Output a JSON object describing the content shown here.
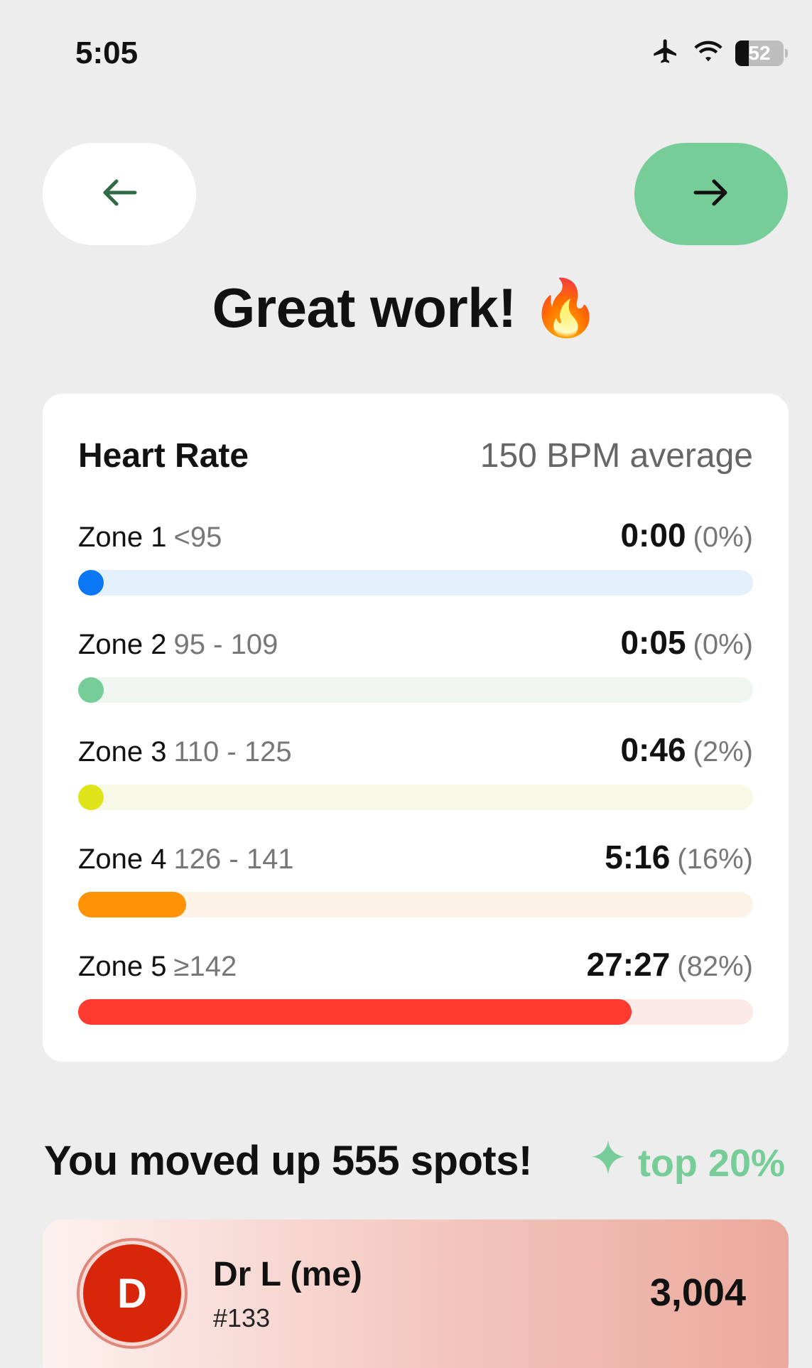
{
  "status_bar": {
    "time": "5:05",
    "battery": "52",
    "battery_level_percent": 52
  },
  "nav": {
    "back_icon": "arrow-left-icon",
    "next_icon": "arrow-right-icon"
  },
  "title": "Great work! 🔥",
  "heart_rate": {
    "title": "Heart Rate",
    "average": "150 BPM average",
    "zones": [
      {
        "name": "Zone 1",
        "range": "<95",
        "time": "0:00",
        "percent_label": "(0%)",
        "percent": 0,
        "color": "#0a77f5",
        "track_color": "#e4f0fb"
      },
      {
        "name": "Zone 2",
        "range": "95 - 109",
        "time": "0:05",
        "percent_label": "(0%)",
        "percent": 0,
        "color": "#76cd98",
        "track_color": "#eff6f1"
      },
      {
        "name": "Zone 3",
        "range": "110 - 125",
        "time": "0:46",
        "percent_label": "(2%)",
        "percent": 2,
        "color": "#dfe31a",
        "track_color": "#f7f9e6"
      },
      {
        "name": "Zone 4",
        "range": "126 - 141",
        "time": "5:16",
        "percent_label": "(16%)",
        "percent": 16,
        "color": "#ff9305",
        "track_color": "#fcf2e6"
      },
      {
        "name": "Zone 5",
        "range": "≥142",
        "time": "27:27",
        "percent_label": "(82%)",
        "percent": 82,
        "color": "#ff3b30",
        "track_color": "#fbe9e8"
      }
    ]
  },
  "leaderboard": {
    "moved_up": "You moved up 555 spots!",
    "top_percent": "top 20%",
    "sparkle_icon": "sparkle-icon",
    "accent_color": "#76cd98",
    "me": {
      "initial": "D",
      "name": "Dr L (me)",
      "rank": "#133",
      "score": "3,004"
    }
  }
}
